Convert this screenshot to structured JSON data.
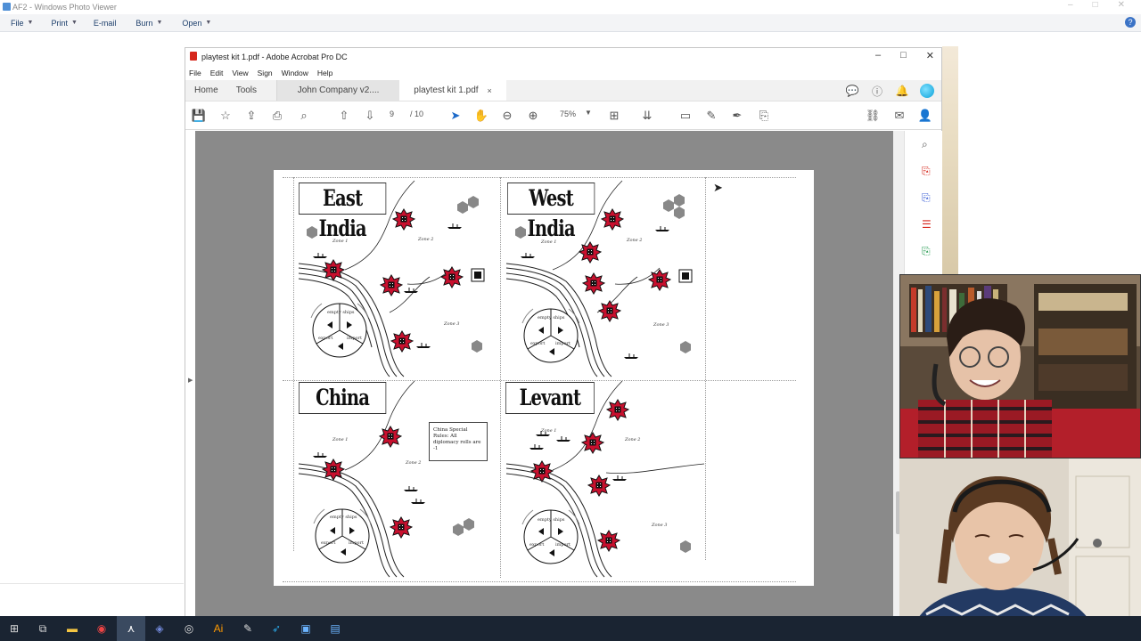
{
  "photo_viewer": {
    "title": "AF2 - Windows Photo Viewer",
    "menu": [
      {
        "label": "File",
        "has_caret": true
      },
      {
        "label": "Print",
        "has_caret": true
      },
      {
        "label": "E-mail",
        "has_caret": false
      },
      {
        "label": "Burn",
        "has_caret": true
      },
      {
        "label": "Open",
        "has_caret": true
      }
    ],
    "help_icon": "help-icon"
  },
  "acrobat": {
    "title": "playtest kit 1.pdf - Adobe Acrobat Pro DC",
    "menu": [
      "File",
      "Edit",
      "View",
      "Sign",
      "Window",
      "Help"
    ],
    "tabs": {
      "home": "Home",
      "tools": "Tools",
      "doc1": "John Company v2....",
      "doc2": "playtest kit 1.pdf",
      "close_symbol": "×"
    },
    "toolbar": {
      "page_current": "9",
      "page_total": "/ 10",
      "zoom": "75%"
    },
    "window_buttons": [
      "–",
      "□",
      "✕"
    ]
  },
  "pdf_page": {
    "regions": [
      {
        "title": "East India",
        "zones": [
          "Zone 1",
          "Zone 2",
          "Zone 3"
        ],
        "compass": {
          "top": "empty ships",
          "left": "export",
          "right": "import"
        }
      },
      {
        "title": "West India",
        "zones": [
          "Zone 1",
          "Zone 2",
          "Zone 3"
        ],
        "compass": {
          "top": "empty ships",
          "left": "export",
          "right": "import"
        }
      },
      {
        "title": "China",
        "zones": [
          "Zone 1",
          "Zone 2"
        ],
        "compass": {
          "top": "empty ships",
          "left": "export",
          "right": "import"
        },
        "note": "China Special Rules: All diplomacy rolls are -1"
      },
      {
        "title": "Levant",
        "zones": [
          "Zone 1",
          "Zone 2",
          "Zone 3"
        ],
        "compass": {
          "top": "empty ships",
          "left": "export",
          "right": "import"
        }
      }
    ]
  },
  "colors": {
    "acrobat_red": "#d6271c",
    "star_red": "#c8102e",
    "doc_background": "#8a8a8a",
    "taskbar": "#1a2432"
  }
}
